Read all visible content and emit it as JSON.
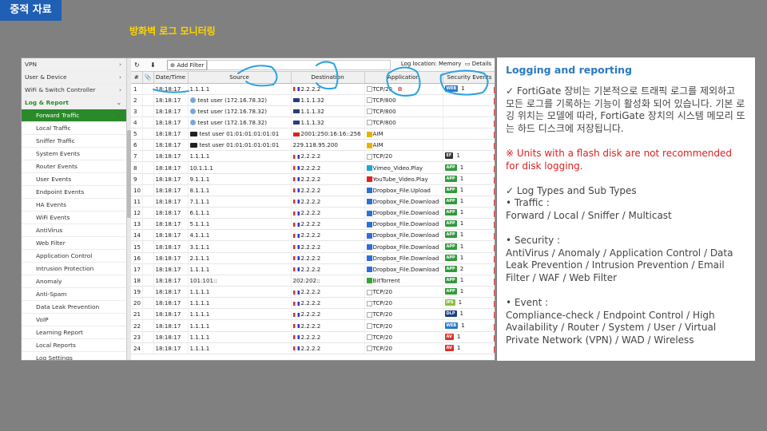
{
  "header": {
    "tag": "중적 자료",
    "title": "방화벽 로그 모니터링"
  },
  "sidebar": {
    "items": [
      {
        "label": "VPN",
        "type": "grp",
        "chev": "›"
      },
      {
        "label": "User & Device",
        "type": "grp",
        "chev": "›"
      },
      {
        "label": "WiFi & Switch Controller",
        "type": "grp",
        "chev": "›"
      },
      {
        "label": "Log & Report",
        "type": "loggrp",
        "chev": "⌄"
      },
      {
        "label": "Forward Traffic",
        "type": "active",
        "chev": "☆"
      },
      {
        "label": "Local Traffic",
        "type": "sub",
        "chev": ""
      },
      {
        "label": "Sniffer Traffic",
        "type": "sub",
        "chev": ""
      },
      {
        "label": "System Events",
        "type": "sub",
        "chev": ""
      },
      {
        "label": "Router Events",
        "type": "sub",
        "chev": ""
      },
      {
        "label": "User Events",
        "type": "sub",
        "chev": ""
      },
      {
        "label": "Endpoint Events",
        "type": "sub",
        "chev": ""
      },
      {
        "label": "HA Events",
        "type": "sub",
        "chev": ""
      },
      {
        "label": "WiFi Events",
        "type": "sub",
        "chev": ""
      },
      {
        "label": "AntiVirus",
        "type": "sub",
        "chev": ""
      },
      {
        "label": "Web Filter",
        "type": "sub",
        "chev": ""
      },
      {
        "label": "Application Control",
        "type": "sub",
        "chev": ""
      },
      {
        "label": "Intrusion Protection",
        "type": "sub",
        "chev": ""
      },
      {
        "label": "Anomaly",
        "type": "sub",
        "chev": ""
      },
      {
        "label": "Anti-Spam",
        "type": "sub",
        "chev": ""
      },
      {
        "label": "Data Leak Prevention",
        "type": "sub",
        "chev": ""
      },
      {
        "label": "VoIP",
        "type": "sub",
        "chev": ""
      },
      {
        "label": "Learning Report",
        "type": "sub",
        "chev": ""
      },
      {
        "label": "Local Reports",
        "type": "sub",
        "chev": ""
      },
      {
        "label": "Log Settings",
        "type": "sub",
        "chev": ""
      }
    ]
  },
  "toolbar": {
    "refresh_icon": "↻",
    "download_icon": "⬇",
    "add_filter_label": "Add Filter",
    "add_filter_icon": "⊕",
    "log_location": "Log location: Memory",
    "details_label": "Details"
  },
  "table": {
    "headers": [
      "#",
      "📎",
      "Date/Time",
      "Source",
      "Destination",
      "Application",
      "Security Events"
    ],
    "rows": [
      {
        "n": "1",
        "t": "18:18:17",
        "src": "1.1.1.1",
        "srcIcon": "",
        "dst": "2.2.2.2",
        "flag": "fr",
        "app": "TCP/20",
        "appIcon": "box",
        "badge": "WEB",
        "badgeColor": "#2a78c8",
        "sev": "1",
        "x": true
      },
      {
        "n": "2",
        "t": "18:18:17",
        "src": "test user  (172.16.78.32)",
        "srcIcon": "user",
        "dst": "1.1.1.32",
        "flag": "au",
        "app": "TCP/800",
        "appIcon": "box",
        "badge": "",
        "badgeColor": "",
        "sev": "",
        "x": false
      },
      {
        "n": "3",
        "t": "18:18:17",
        "src": "test user  (172.16.78.32)",
        "srcIcon": "user",
        "dst": "1.1.1.32",
        "flag": "au",
        "app": "TCP/800",
        "appIcon": "box",
        "badge": "",
        "badgeColor": "",
        "sev": "",
        "x": false
      },
      {
        "n": "4",
        "t": "18:18:17",
        "src": "test user  (172.16.78.32)",
        "srcIcon": "user",
        "dst": "1.1.1.32",
        "flag": "au",
        "app": "TCP/800",
        "appIcon": "box",
        "badge": "",
        "badgeColor": "",
        "sev": "",
        "x": false
      },
      {
        "n": "5",
        "t": "18:18:17",
        "src": "test user  01:01:01:01:01:01",
        "srcIcon": "dev",
        "dst": "2001:250:16:16::256",
        "flag": "cn",
        "app": "AIM",
        "appIcon": "aim",
        "badge": "",
        "badgeColor": "",
        "sev": "",
        "x": false
      },
      {
        "n": "6",
        "t": "18:18:17",
        "src": "test user  01:01:01:01:01:01",
        "srcIcon": "dev",
        "dst": "229.118.95.200",
        "flag": "",
        "app": "AIM",
        "appIcon": "aim",
        "badge": "",
        "badgeColor": "",
        "sev": "",
        "x": false
      },
      {
        "n": "7",
        "t": "18:18:17",
        "src": "1.1.1.1",
        "srcIcon": "",
        "dst": "2.2.2.2",
        "flag": "fr",
        "app": "TCP/20",
        "appIcon": "box",
        "badge": "EF",
        "badgeColor": "#333",
        "sev": "1",
        "x": false
      },
      {
        "n": "8",
        "t": "18:18:17",
        "src": "10.1.1.1",
        "srcIcon": "",
        "dst": "2.2.2.2",
        "flag": "fr",
        "app": "Vimeo_Video.Play",
        "appIcon": "vimeo",
        "badge": "APP",
        "badgeColor": "#2f9a3a",
        "sev": "1",
        "x": false
      },
      {
        "n": "9",
        "t": "18:18:17",
        "src": "9.1.1.1",
        "srcIcon": "",
        "dst": "2.2.2.2",
        "flag": "fr",
        "app": "YouTube_Video.Play",
        "appIcon": "yt",
        "badge": "APP",
        "badgeColor": "#2f9a3a",
        "sev": "1",
        "x": false
      },
      {
        "n": "10",
        "t": "18:18:17",
        "src": "8.1.1.1",
        "srcIcon": "",
        "dst": "2.2.2.2",
        "flag": "fr",
        "app": "Dropbox_File.Upload",
        "appIcon": "dbx",
        "badge": "APP",
        "badgeColor": "#2f9a3a",
        "sev": "1",
        "x": false
      },
      {
        "n": "11",
        "t": "18:18:17",
        "src": "7.1.1.1",
        "srcIcon": "",
        "dst": "2.2.2.2",
        "flag": "fr",
        "app": "Dropbox_File.Download",
        "appIcon": "dbx",
        "badge": "APP",
        "badgeColor": "#2f9a3a",
        "sev": "1",
        "x": false
      },
      {
        "n": "12",
        "t": "18:18:17",
        "src": "6.1.1.1",
        "srcIcon": "",
        "dst": "2.2.2.2",
        "flag": "fr",
        "app": "Dropbox_File.Download",
        "appIcon": "dbx",
        "badge": "APP",
        "badgeColor": "#2f9a3a",
        "sev": "1",
        "x": false
      },
      {
        "n": "13",
        "t": "18:18:17",
        "src": "5.1.1.1",
        "srcIcon": "",
        "dst": "2.2.2.2",
        "flag": "fr",
        "app": "Dropbox_File.Download",
        "appIcon": "dbx",
        "badge": "APP",
        "badgeColor": "#2f9a3a",
        "sev": "1",
        "x": false
      },
      {
        "n": "14",
        "t": "18:18:17",
        "src": "4.1.1.1",
        "srcIcon": "",
        "dst": "2.2.2.2",
        "flag": "fr",
        "app": "Dropbox_File.Download",
        "appIcon": "dbx",
        "badge": "APP",
        "badgeColor": "#2f9a3a",
        "sev": "1",
        "x": false
      },
      {
        "n": "15",
        "t": "18:18:17",
        "src": "3.1.1.1",
        "srcIcon": "",
        "dst": "2.2.2.2",
        "flag": "fr",
        "app": "Dropbox_File.Download",
        "appIcon": "dbx",
        "badge": "APP",
        "badgeColor": "#2f9a3a",
        "sev": "1",
        "x": false
      },
      {
        "n": "16",
        "t": "18:18:17",
        "src": "2.1.1.1",
        "srcIcon": "",
        "dst": "2.2.2.2",
        "flag": "fr",
        "app": "Dropbox_File.Download",
        "appIcon": "dbx",
        "badge": "APP",
        "badgeColor": "#2f9a3a",
        "sev": "1",
        "x": false
      },
      {
        "n": "17",
        "t": "18:18:17",
        "src": "1.1.1.1",
        "srcIcon": "",
        "dst": "2.2.2.2",
        "flag": "fr",
        "app": "Dropbox_File.Download",
        "appIcon": "dbx",
        "badge": "APP",
        "badgeColor": "#2f9a3a",
        "sev": "2",
        "x": false
      },
      {
        "n": "18",
        "t": "18:18:17",
        "src": "101:101::",
        "srcIcon": "",
        "dst": "202:202::",
        "flag": "",
        "app": "BitTorrent",
        "appIcon": "bt",
        "badge": "APP",
        "badgeColor": "#2f9a3a",
        "sev": "1",
        "x": false
      },
      {
        "n": "19",
        "t": "18:18:17",
        "src": "1.1.1.1",
        "srcIcon": "",
        "dst": "2.2.2.2",
        "flag": "fr",
        "app": "TCP/20",
        "appIcon": "box",
        "badge": "APP",
        "badgeColor": "#2f9a3a",
        "sev": "1",
        "x": false
      },
      {
        "n": "20",
        "t": "18:18:17",
        "src": "1.1.1.1",
        "srcIcon": "",
        "dst": "2.2.2.2",
        "flag": "fr",
        "app": "TCP/20",
        "appIcon": "box",
        "badge": "IPS",
        "badgeColor": "#8cbf3c",
        "sev": "1",
        "x": false
      },
      {
        "n": "21",
        "t": "18:18:17",
        "src": "1.1.1.1",
        "srcIcon": "",
        "dst": "2.2.2.2",
        "flag": "fr",
        "app": "TCP/20",
        "appIcon": "box",
        "badge": "DLP",
        "badgeColor": "#1c3f8a",
        "sev": "1",
        "x": false
      },
      {
        "n": "22",
        "t": "18:18:17",
        "src": "1.1.1.1",
        "srcIcon": "",
        "dst": "2.2.2.2",
        "flag": "fr",
        "app": "TCP/20",
        "appIcon": "box",
        "badge": "WEB",
        "badgeColor": "#2a78c8",
        "sev": "1",
        "x": false
      },
      {
        "n": "23",
        "t": "18:18:17",
        "src": "1.1.1.1",
        "srcIcon": "",
        "dst": "2.2.2.2",
        "flag": "fr",
        "app": "TCP/20",
        "appIcon": "box",
        "badge": "AV",
        "badgeColor": "#e0302a",
        "sev": "1",
        "x": false
      },
      {
        "n": "24",
        "t": "18:18:17",
        "src": "1.1.1.1",
        "srcIcon": "",
        "dst": "2.2.2.2",
        "flag": "fr",
        "app": "TCP/20",
        "appIcon": "box",
        "badge": "AV",
        "badgeColor": "#e0302a",
        "sev": "1",
        "x": false
      }
    ]
  },
  "panel": {
    "title": "Logging and reporting",
    "intro": "✓ FortiGate 장비는 기본적으로 트래픽 로그를 제외하고 모든 로그를 기록하는 기능이 활성화 되어 있습니다. 기본 로깅 위치는 모델에 따라, FortiGate 장치의 시스템 메모리 또는 하드 디스크에 저장됩니다.",
    "warning": "※ Units with a flash disk are not recommended for disk logging.",
    "types_heading": "✓ Log Types and Sub Types",
    "traffic_label": "•  Traffic :",
    "traffic_list": "Forward / Local / Sniffer / Multicast",
    "security_label": "•  Security :",
    "security_list": "AntiVirus / Anomaly / Application Control / Data Leak Prevention / Intrusion Prevention / Email Filter / WAF / Web Filter",
    "event_label": "•  Event :",
    "event_list": "Compliance-check / Endpoint Control / High Availability / Router / System / User / Virtual Private Network (VPN) / WAD / Wireless"
  },
  "colors": {
    "accent_blue": "#2b79c2",
    "tag_bg": "#1f5fb4",
    "title_yellow": "#ffd400",
    "active_green": "#2a8a2a",
    "warning_red": "#e02020",
    "annotation": "#29a3e0"
  }
}
